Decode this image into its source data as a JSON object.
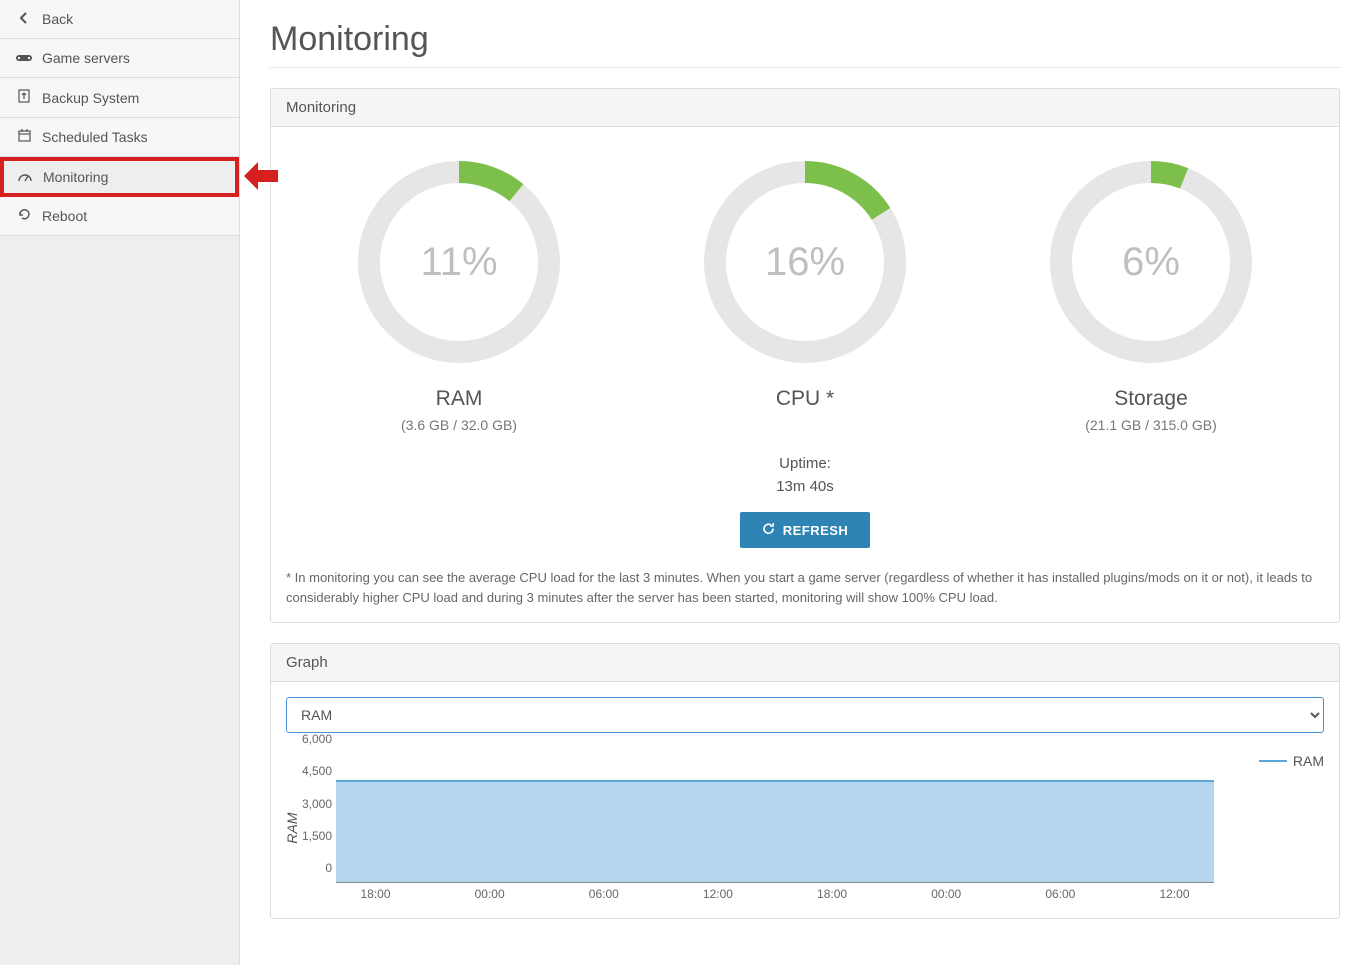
{
  "sidebar": {
    "items": [
      {
        "label": "Back",
        "icon": "chevron-left"
      },
      {
        "label": "Game servers",
        "icon": "gamepad"
      },
      {
        "label": "Backup System",
        "icon": "file-upload"
      },
      {
        "label": "Scheduled Tasks",
        "icon": "calendar"
      },
      {
        "label": "Monitoring",
        "icon": "dashboard"
      },
      {
        "label": "Reboot",
        "icon": "refresh"
      }
    ],
    "active_index": 4
  },
  "page": {
    "title": "Monitoring"
  },
  "panels": {
    "monitoring": "Monitoring",
    "graph": "Graph"
  },
  "gauges": {
    "ram": {
      "pct": 11,
      "pct_text": "11%",
      "label": "RAM",
      "sub": "(3.6 GB / 32.0 GB)"
    },
    "cpu": {
      "pct": 16,
      "pct_text": "16%",
      "label": "CPU *",
      "sub": ""
    },
    "storage": {
      "pct": 6,
      "pct_text": "6%",
      "label": "Storage",
      "sub": "(21.1 GB / 315.0 GB)"
    }
  },
  "uptime": {
    "label": "Uptime:",
    "value": "13m 40s"
  },
  "buttons": {
    "refresh": "REFRESH"
  },
  "footnote": "* In monitoring you can see the average CPU load for the last 3 minutes. When you start a game server (regardless of whether it has installed plugins/mods on it or not), it leads to considerably higher CPU load and during 3 minutes after the server has been started, monitoring will show 100% CPU load.",
  "graph": {
    "select_value": "RAM",
    "ylabel": "RAM",
    "legend": "RAM"
  },
  "chart_data": {
    "type": "area",
    "title": "",
    "xlabel": "",
    "ylabel": "RAM",
    "ylim": [
      0,
      6000
    ],
    "yticks": [
      0,
      1500,
      3000,
      4500,
      6000
    ],
    "categories": [
      "18:00",
      "00:00",
      "06:00",
      "12:00",
      "18:00",
      "00:00",
      "06:00",
      "12:00"
    ],
    "series": [
      {
        "name": "RAM",
        "values": [
          4700,
          4650,
          4700,
          4750,
          4800,
          4700,
          4750,
          4800
        ]
      }
    ]
  }
}
